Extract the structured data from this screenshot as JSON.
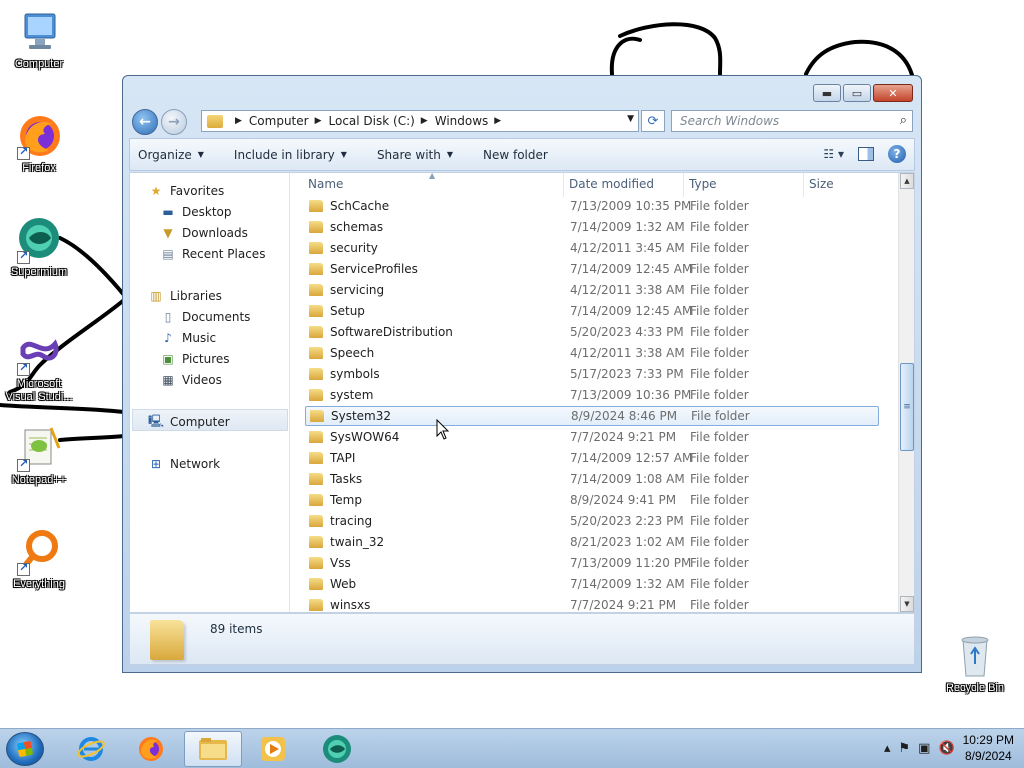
{
  "desktop": {
    "icons": [
      {
        "label": "Computer"
      },
      {
        "label": "Firefox"
      },
      {
        "label": "Supermium"
      },
      {
        "label": "Microsoft Visual Studi..."
      },
      {
        "label": "Notepad++"
      },
      {
        "label": "Everything"
      },
      {
        "label": "Recycle Bin"
      }
    ]
  },
  "window": {
    "address": {
      "crumbs": [
        "Computer",
        "Local Disk (C:)",
        "Windows"
      ]
    },
    "search_placeholder": "Search Windows",
    "commands": {
      "organize": "Organize",
      "include_in_library": "Include in library",
      "share_with": "Share with",
      "new_folder": "New folder"
    },
    "columns": {
      "name": "Name",
      "date_modified": "Date modified",
      "type": "Type",
      "size": "Size"
    },
    "nav": {
      "favorites": "Favorites",
      "desktop": "Desktop",
      "downloads": "Downloads",
      "recent_places": "Recent Places",
      "libraries": "Libraries",
      "documents": "Documents",
      "music": "Music",
      "pictures": "Pictures",
      "videos": "Videos",
      "computer": "Computer",
      "network": "Network"
    },
    "files": [
      {
        "name": "SchCache",
        "date": "7/13/2009 10:35 PM",
        "type": "File folder"
      },
      {
        "name": "schemas",
        "date": "7/14/2009 1:32 AM",
        "type": "File folder"
      },
      {
        "name": "security",
        "date": "4/12/2011 3:45 AM",
        "type": "File folder"
      },
      {
        "name": "ServiceProfiles",
        "date": "7/14/2009 12:45 AM",
        "type": "File folder"
      },
      {
        "name": "servicing",
        "date": "4/12/2011 3:38 AM",
        "type": "File folder"
      },
      {
        "name": "Setup",
        "date": "7/14/2009 12:45 AM",
        "type": "File folder"
      },
      {
        "name": "SoftwareDistribution",
        "date": "5/20/2023 4:33 PM",
        "type": "File folder"
      },
      {
        "name": "Speech",
        "date": "4/12/2011 3:38 AM",
        "type": "File folder"
      },
      {
        "name": "symbols",
        "date": "5/17/2023 7:33 PM",
        "type": "File folder"
      },
      {
        "name": "system",
        "date": "7/13/2009 10:36 PM",
        "type": "File folder"
      },
      {
        "name": "System32",
        "date": "8/9/2024 8:46 PM",
        "type": "File folder"
      },
      {
        "name": "SysWOW64",
        "date": "7/7/2024 9:21 PM",
        "type": "File folder"
      },
      {
        "name": "TAPI",
        "date": "7/14/2009 12:57 AM",
        "type": "File folder"
      },
      {
        "name": "Tasks",
        "date": "7/14/2009 1:08 AM",
        "type": "File folder"
      },
      {
        "name": "Temp",
        "date": "8/9/2024 9:41 PM",
        "type": "File folder"
      },
      {
        "name": "tracing",
        "date": "5/20/2023 2:23 PM",
        "type": "File folder"
      },
      {
        "name": "twain_32",
        "date": "8/21/2023 1:02 AM",
        "type": "File folder"
      },
      {
        "name": "Vss",
        "date": "7/13/2009 11:20 PM",
        "type": "File folder"
      },
      {
        "name": "Web",
        "date": "7/14/2009 1:32 AM",
        "type": "File folder"
      },
      {
        "name": "winsxs",
        "date": "7/7/2024 9:21 PM",
        "type": "File folder"
      }
    ],
    "selected_file": "System32",
    "status": {
      "item_count": "89 items"
    }
  },
  "taskbar": {
    "clock_time": "10:29 PM",
    "clock_date": "8/9/2024"
  }
}
